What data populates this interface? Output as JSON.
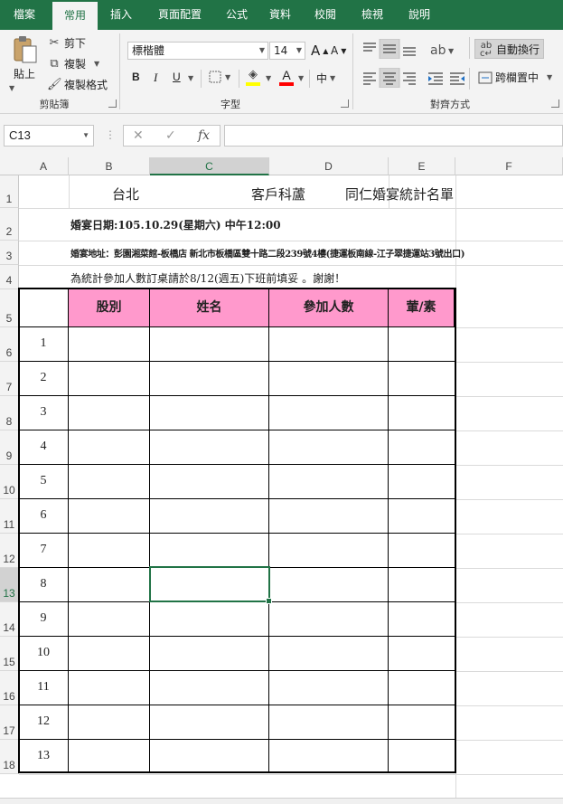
{
  "ribbon_tabs": [
    "檔案",
    "常用",
    "插入",
    "頁面配置",
    "公式",
    "資料",
    "校閱",
    "檢視",
    "說明"
  ],
  "clipboard": {
    "paste": "貼上",
    "cut": "剪下",
    "copy": "複製",
    "format_painter": "複製格式",
    "label": "剪貼簿"
  },
  "font": {
    "name": "標楷體",
    "size": "14",
    "grow": "A",
    "shrink": "A",
    "bold": "B",
    "italic": "I",
    "underline": "U",
    "font_color_glyph": "A",
    "phonetic": "中",
    "label": "字型"
  },
  "alignment": {
    "wrap_text": "自動換行",
    "merge_center": "跨欄置中",
    "label": "對齊方式"
  },
  "colors": {
    "accent": "#217346",
    "header_fill": "#ff99cc",
    "fill_yellow": "#ffff00",
    "font_red": "#ff0000"
  },
  "formula_bar": {
    "name_box": "C13",
    "fx": "fx",
    "value": ""
  },
  "columns": [
    "A",
    "B",
    "C",
    "D",
    "E",
    "F"
  ],
  "rows": [
    "1",
    "2",
    "3",
    "4",
    "5",
    "6",
    "7",
    "8",
    "9",
    "10",
    "11",
    "12",
    "13",
    "14",
    "15",
    "16",
    "17",
    "18"
  ],
  "sheet": {
    "title_city": "台北",
    "title_company": "客戶科蘆",
    "title_main": "同仁婚宴統計名單",
    "date_line": "婚宴日期:105.10.29(星期六)  中午12:00",
    "address_line": "婚宴地址：彭園湘菜館-板橋店 新北市板橋區雙十路二段239號4樓(捷運板南線-江子翠捷運站3號出口)",
    "notice_line": "為統計參加人數訂桌請於8/12(週五)下班前填妥 。謝謝！",
    "headers": [
      "股別",
      "姓名",
      "參加人數",
      "葷/素"
    ],
    "numbers": [
      "1",
      "2",
      "3",
      "4",
      "5",
      "6",
      "7",
      "8",
      "9",
      "10",
      "11",
      "12",
      "13"
    ]
  }
}
